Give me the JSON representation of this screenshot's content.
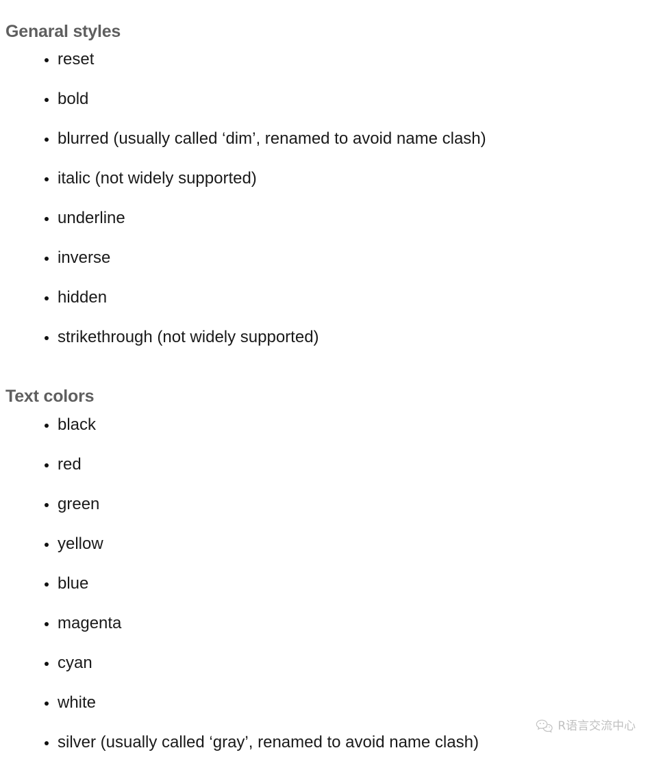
{
  "document": {
    "sections": [
      {
        "heading": "Genaral styles",
        "items": [
          "reset",
          "bold",
          "blurred (usually called ‘dim’, renamed to avoid name clash)",
          "italic (not widely supported)",
          "underline",
          "inverse",
          "hidden",
          "strikethrough (not widely supported)"
        ]
      },
      {
        "heading": "Text colors",
        "items": [
          "black",
          "red",
          "green",
          "yellow",
          "blue",
          "magenta",
          "cyan",
          "white",
          "silver (usually called ‘gray’, renamed to avoid name clash)"
        ]
      }
    ]
  },
  "watermark": {
    "icon": "wechat-icon",
    "text": "R语言交流中心"
  },
  "colors": {
    "page_background": "#ffffff",
    "heading_text": "#5f5f5f",
    "body_text": "#1a1a1a",
    "bullet_marker": "#111111",
    "watermark_text": "#8d8d8d"
  }
}
